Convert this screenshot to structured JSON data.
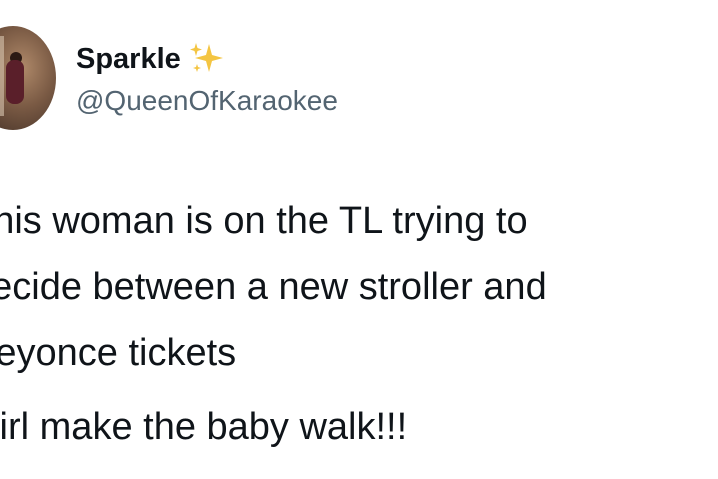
{
  "tweet": {
    "author": {
      "display_name": "Sparkle",
      "name_emoji": "sparkles-icon",
      "handle": "@QueenOfKaraokee"
    },
    "lines": [
      "This woman is on the TL trying to",
      "decide between a new stroller and",
      "Beyonce tickets"
    ],
    "reply_line": "Girl make the baby walk!!!"
  },
  "colors": {
    "text_primary": "#0f1419",
    "text_secondary": "#536471",
    "sparkle_gold": "#f4c542"
  }
}
